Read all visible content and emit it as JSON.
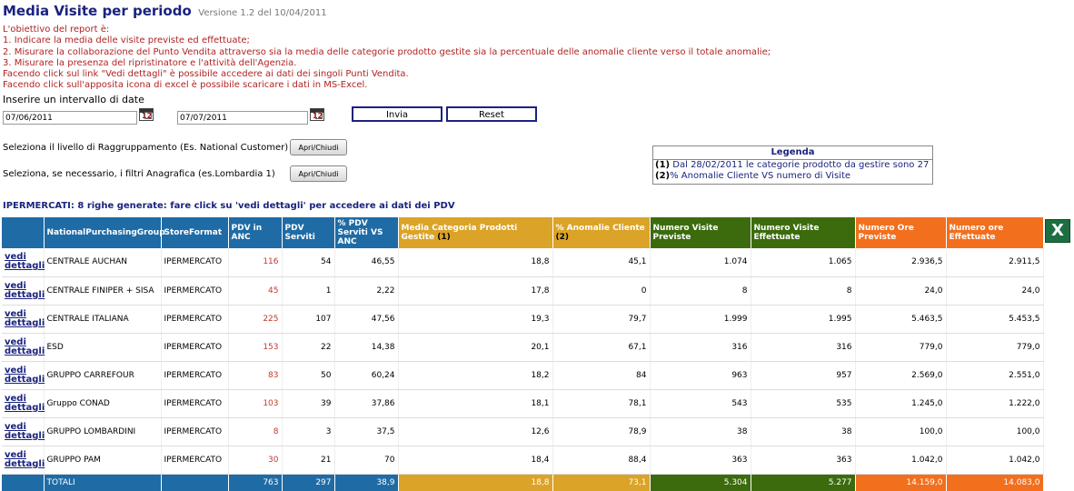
{
  "page": {
    "title": "Media Visite per periodo",
    "version": "Versione 1.2 del 10/04/2011"
  },
  "intro_lines": [
    "L'obiettivo del report è:",
    "1. Indicare la media delle visite previste ed effettuate;",
    "2. Misurare la collaborazione del Punto Vendita attraverso sia la media delle categorie prodotto gestite sia la percentuale delle anomalie cliente verso il totale anomalie;",
    "3. Misurare la presenza del ripristinatore e l'attività dell'Agenzia.",
    "Facendo click sul link \"Vedi dettagli\" è possibile accedere ai dati dei singoli Punti Vendita.",
    "Facendo click sull'apposita icona di excel è possibile scaricare i dati in MS-Excel."
  ],
  "date_range": {
    "label": "Inserire un intervallo di date",
    "start": "07/06/2011",
    "end": "07/07/2011",
    "calendar_icon_text": "12"
  },
  "buttons": {
    "send": "Invia",
    "reset": "Reset",
    "toggle": "Apri/Chiudi"
  },
  "filters": {
    "grouping_label": "Seleziona il livello di Raggruppamento (Es. National Customer)",
    "anagrafica_label": "Seleziona, se necessario, i filtri Anagrafica (es.Lombardia 1)"
  },
  "legend": {
    "title": "Legenda",
    "items": [
      {
        "num": "(1)",
        "text": " Dal 28/02/2011 le categorie prodotto da gestire sono 27"
      },
      {
        "num": "(2)",
        "text": "% Anomalie Cliente VS numero di Visite"
      }
    ]
  },
  "summary": "IPERMERCATI: 8 righe generate: fare click su 'vedi dettagli' per accedere ai dati dei PDV",
  "table": {
    "headers": [
      "",
      "NationalPurchasingGroup",
      "StoreFormat",
      "PDV in ANC",
      "PDV Serviti",
      "% PDV Serviti VS ANC",
      "Media Categoria Prodotti Gestite",
      "% Anomalie Cliente",
      "Numero Visite Previste",
      "Numero Visite Effettuate",
      "Numero Ore Previste",
      "Numero ore Effettuate"
    ],
    "header_markers": {
      "media": "(1)",
      "anomalie": "(2)"
    },
    "link_line1": "vedi",
    "link_line2": "dettagli",
    "rows": [
      [
        "CENTRALE AUCHAN",
        "IPERMERCATO",
        "116",
        "54",
        "46,55",
        "18,8",
        "45,1",
        "1.074",
        "1.065",
        "2.936,5",
        "2.911,5"
      ],
      [
        "CENTRALE FINIPER + SISA",
        "IPERMERCATO",
        "45",
        "1",
        "2,22",
        "17,8",
        "0",
        "8",
        "8",
        "24,0",
        "24,0"
      ],
      [
        "CENTRALE ITALIANA",
        "IPERMERCATO",
        "225",
        "107",
        "47,56",
        "19,3",
        "79,7",
        "1.999",
        "1.995",
        "5.463,5",
        "5.453,5"
      ],
      [
        "ESD",
        "IPERMERCATO",
        "153",
        "22",
        "14,38",
        "20,1",
        "67,1",
        "316",
        "316",
        "779,0",
        "779,0"
      ],
      [
        "GRUPPO CARREFOUR",
        "IPERMERCATO",
        "83",
        "50",
        "60,24",
        "18,2",
        "84",
        "963",
        "957",
        "2.569,0",
        "2.551,0"
      ],
      [
        "Gruppo CONAD",
        "IPERMERCATO",
        "103",
        "39",
        "37,86",
        "18,1",
        "78,1",
        "543",
        "535",
        "1.245,0",
        "1.222,0"
      ],
      [
        "GRUPPO LOMBARDINI",
        "IPERMERCATO",
        "8",
        "3",
        "37,5",
        "12,6",
        "78,9",
        "38",
        "38",
        "100,0",
        "100,0"
      ],
      [
        "GRUPPO PAM",
        "IPERMERCATO",
        "30",
        "21",
        "70",
        "18,4",
        "88,4",
        "363",
        "363",
        "1.042,0",
        "1.042,0"
      ]
    ],
    "totals": [
      "TOTALI",
      "",
      "763",
      "297",
      "38,9",
      "18,8",
      "73,1",
      "5.304",
      "5.277",
      "14.159,0",
      "14.083,0"
    ]
  },
  "excel_icon_label": "X"
}
